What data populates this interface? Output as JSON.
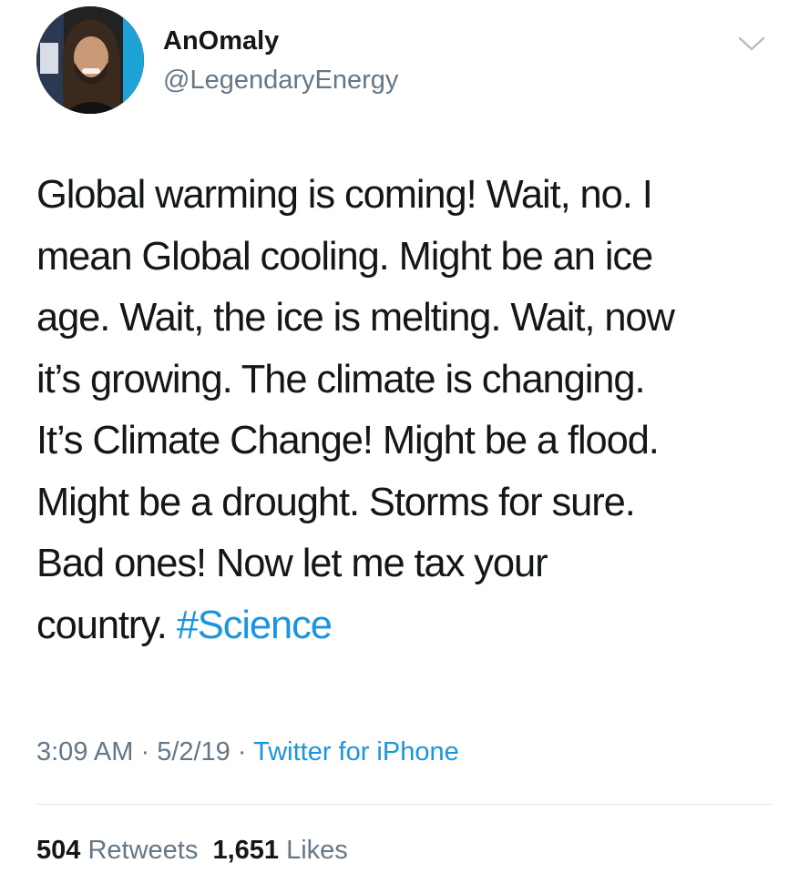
{
  "author": {
    "display_name": "AnOmaly",
    "handle": "@LegendaryEnergy",
    "avatar_icon": "profile-photo"
  },
  "menu": {
    "icon": "chevron-down-icon"
  },
  "tweet": {
    "lines": [
      "Global warming is coming! Wait, no. I",
      "mean Global cooling. Might be an ice",
      "age. Wait, the ice is melting. Wait, now",
      "it’s growing. The climate is changing.",
      "It’s Climate Change! Might be a flood.",
      "Might be a drought. Storms for sure.",
      "Bad ones! Now let me tax your"
    ],
    "last_line_text": "country. ",
    "hashtag": "#Science"
  },
  "meta": {
    "time": "3:09 AM",
    "separator": " · ",
    "date": "5/2/19",
    "source": "Twitter for iPhone"
  },
  "stats": {
    "retweets_count": "504",
    "retweets_label": "Retweets",
    "likes_count": "1,651",
    "likes_label": "Likes"
  },
  "colors": {
    "text": "#14171a",
    "secondary": "#657786",
    "link": "#1b95e0",
    "divider": "#e1e8ed"
  }
}
